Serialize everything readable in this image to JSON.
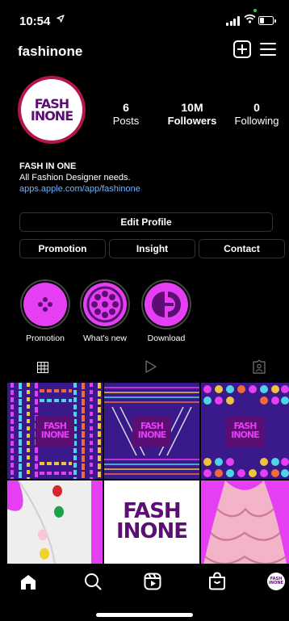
{
  "status_bar": {
    "time": "10:54",
    "location_icon": "location-arrow-icon",
    "signal_icon": "cellular-signal-icon",
    "wifi_icon": "wifi-icon",
    "battery_icon": "battery-icon",
    "battery_level": 0.3
  },
  "header": {
    "username": "fashinone",
    "new_post_icon": "plus-square-icon",
    "menu_icon": "hamburger-menu-icon"
  },
  "profile": {
    "avatar_text": [
      "FASH",
      "IN",
      "ONE"
    ],
    "stats": [
      {
        "value": "6",
        "label": "Posts"
      },
      {
        "value": "10M",
        "label": "Followers"
      },
      {
        "value": "0",
        "label": "Following"
      }
    ],
    "name": "FASH IN ONE",
    "bio": "All Fashion Designer needs.",
    "link": "apps.apple.com/app/fashinone"
  },
  "buttons": {
    "edit_profile": "Edit Profile",
    "promotion": "Promotion",
    "insight": "Insight",
    "contact": "Contact"
  },
  "highlights": [
    {
      "label": "Promotion",
      "icon": "button-four-holes-icon"
    },
    {
      "label": "What's new",
      "icon": "button-many-holes-icon"
    },
    {
      "label": "Download",
      "icon": "download-logo-icon"
    }
  ],
  "tabs": [
    {
      "name": "grid",
      "icon": "grid-icon",
      "active": true
    },
    {
      "name": "reels",
      "icon": "play-icon",
      "active": false
    },
    {
      "name": "tagged",
      "icon": "tagged-person-icon",
      "active": false
    }
  ],
  "grid_posts": {
    "logo_text": [
      "FASH",
      "IN",
      "ONE"
    ]
  },
  "bottom_nav": [
    {
      "name": "home",
      "icon": "home-icon",
      "active": true
    },
    {
      "name": "search",
      "icon": "search-icon"
    },
    {
      "name": "reels",
      "icon": "reels-icon"
    },
    {
      "name": "shop",
      "icon": "shopping-bag-icon"
    },
    {
      "name": "profile",
      "icon": "profile-avatar-icon"
    }
  ],
  "colors": {
    "accent_pink": "#e63ef3",
    "brand_purple": "#5b0f73",
    "ring": "#b3164e",
    "link": "#6cb4ff"
  }
}
